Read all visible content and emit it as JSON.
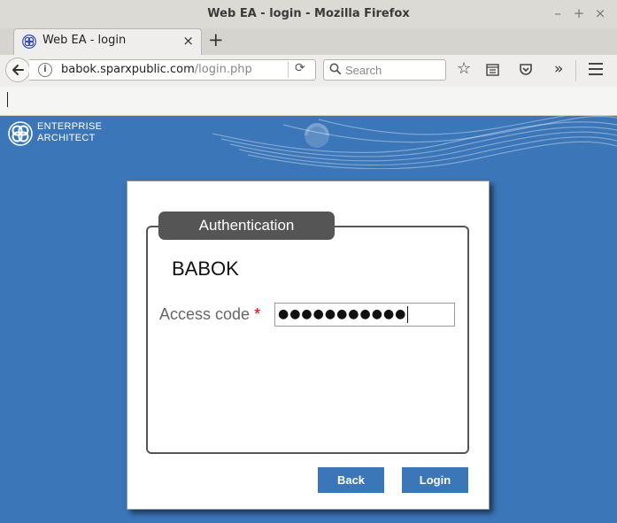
{
  "window": {
    "title": "Web EA - login - Mozilla Firefox",
    "controls": [
      "–",
      "+",
      "×"
    ]
  },
  "tab": {
    "title": "Web EA - login",
    "close_glyph": "×",
    "new_tab_glyph": "+"
  },
  "navbar": {
    "url_host": "babok.sparxpublic.com",
    "url_path": "/login.php",
    "search_placeholder": "Search"
  },
  "brand": {
    "line1": "ENTERPRISE",
    "line2": "ARCHITECT"
  },
  "login": {
    "legend": "Authentication",
    "model_name": "BABOK",
    "access_code_label": "Access code ",
    "required_marker": "*",
    "access_code_value": "●●●●●●●●●●●",
    "back_label": "Back",
    "login_label": "Login"
  },
  "colors": {
    "page_background": "#3b76b8",
    "button": "#3b76b8",
    "legend": "#555555"
  }
}
